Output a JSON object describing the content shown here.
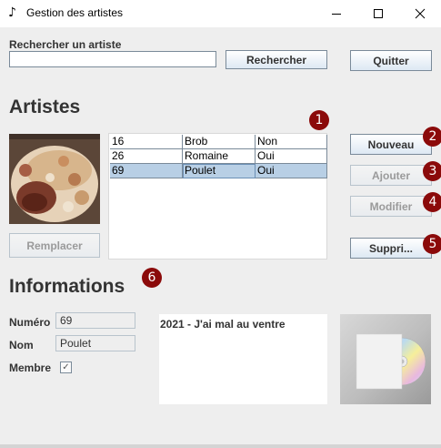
{
  "window": {
    "title": "Gestion des artistes",
    "icon": "music-note-icon",
    "controls": [
      "minimize-icon",
      "maximize-icon",
      "close-icon"
    ]
  },
  "search": {
    "label": "Rechercher un artiste",
    "value": "",
    "button_label": "Rechercher"
  },
  "quit_label": "Quitter",
  "artists": {
    "heading": "Artistes",
    "rows": [
      {
        "id": "16",
        "name": "Brob",
        "member": "Non"
      },
      {
        "id": "26",
        "name": "Romaine",
        "member": "Oui"
      },
      {
        "id": "69",
        "name": "Poulet",
        "member": "Oui",
        "selected": true
      }
    ],
    "replace_label": "Remplacer",
    "photo": "artist-photo"
  },
  "actions": {
    "new_label": "Nouveau",
    "add_label": "Ajouter",
    "modify_label": "Modifier",
    "delete_label": "Suppri..."
  },
  "badges": [
    "1",
    "2",
    "3",
    "4",
    "5",
    "6"
  ],
  "info": {
    "heading": "Informations",
    "numero_label": "Numéro",
    "numero_value": "69",
    "nom_label": "Nom",
    "nom_value": "Poulet",
    "membre_label": "Membre",
    "membre_checked": true,
    "checkmark": "✓"
  },
  "albums": {
    "entries": [
      "2021 - J'ai mal au ventre"
    ],
    "cover": "cd-cover-icon"
  },
  "colors": {
    "badge": "#8b0a0a",
    "selection": "#b8cfe5",
    "background": "#eeeeee"
  }
}
